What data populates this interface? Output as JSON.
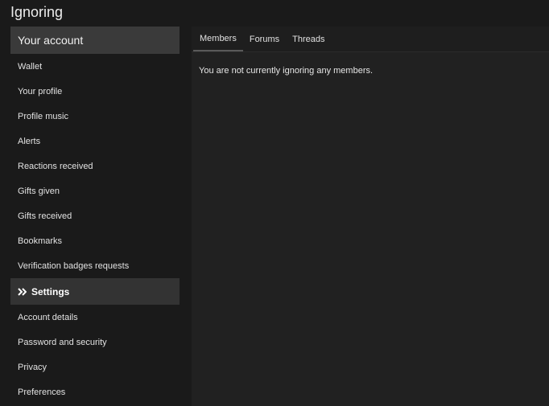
{
  "page": {
    "title": "Ignoring"
  },
  "sidebar": {
    "header": "Your account",
    "account_items": [
      {
        "label": "Wallet"
      },
      {
        "label": "Your profile"
      },
      {
        "label": "Profile music"
      },
      {
        "label": "Alerts"
      },
      {
        "label": "Reactions received"
      },
      {
        "label": "Gifts given"
      },
      {
        "label": "Gifts received"
      },
      {
        "label": "Bookmarks"
      },
      {
        "label": "Verification badges requests"
      }
    ],
    "settings_section": {
      "label": "Settings",
      "icon": "double-chevron-right-icon"
    },
    "settings_items": [
      {
        "label": "Account details"
      },
      {
        "label": "Password and security"
      },
      {
        "label": "Privacy"
      },
      {
        "label": "Preferences"
      }
    ]
  },
  "main": {
    "tabs": [
      {
        "label": "Members",
        "active": true
      },
      {
        "label": "Forums",
        "active": false
      },
      {
        "label": "Threads",
        "active": false
      }
    ],
    "empty_message": "You are not currently ignoring any members."
  },
  "colors": {
    "background": "#1a1a1a",
    "panel": "#212121",
    "header_bg": "#3a3a3a",
    "section_bg": "#333333",
    "text": "#e6e6e6"
  }
}
